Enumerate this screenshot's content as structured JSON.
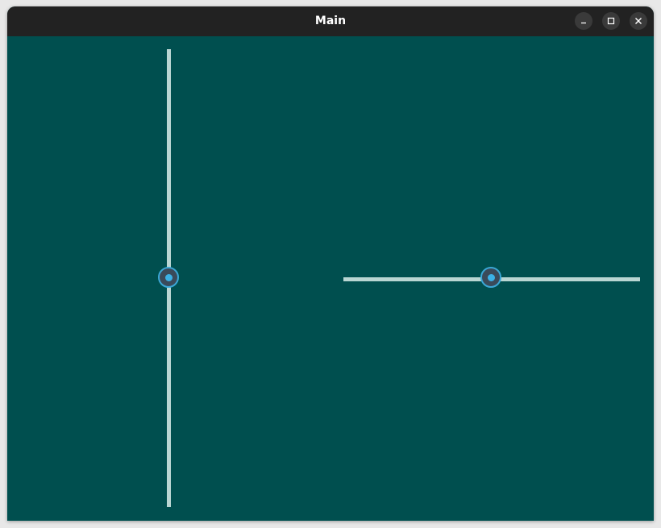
{
  "window": {
    "title": "Main"
  },
  "titlebar_buttons": {
    "minimize_icon": "minimize-icon",
    "maximize_icon": "maximize-icon",
    "close_icon": "close-icon"
  },
  "sliders": {
    "vertical": {
      "orientation": "vertical",
      "value_fraction": 0.5
    },
    "horizontal": {
      "orientation": "horizontal",
      "value_fraction": 0.5
    }
  },
  "colors": {
    "background": "#004f4f",
    "titlebar": "#222222",
    "track": "#b9d6d3",
    "handle_accent": "#3ba7d6"
  }
}
